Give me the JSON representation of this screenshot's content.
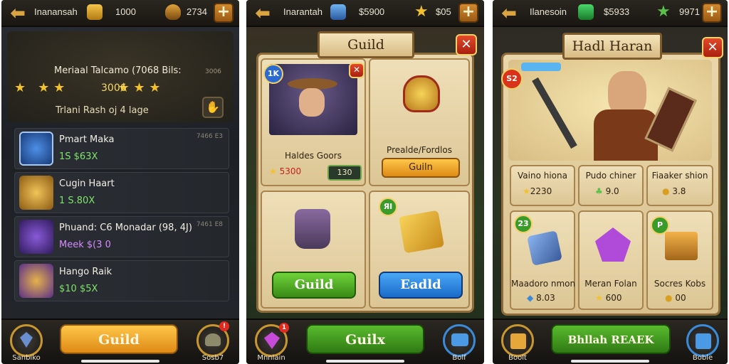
{
  "colors": {
    "gold": "#f2c12b",
    "green_btn": "#4caa22",
    "blue_btn": "#2b8fe6",
    "orange_btn": "#f0a52a",
    "close_red": "#d9331c"
  },
  "panel1": {
    "topbar": {
      "title": "Inanansah",
      "currency_value": "1000",
      "gems_value": "2734",
      "currency_icon": "coin-icon",
      "gem_icon": "shield-gem-icon"
    },
    "header": {
      "title": "Meriaal Talcamo (7068 Bils:",
      "rating": "3006",
      "subtitle": "Trlani Rash oj 4 lage",
      "corner": "3006"
    },
    "rows": [
      {
        "name": "Pmart Maka",
        "sub": "1S $63X",
        "sub_color": "#7ee36a",
        "right": "7466 E3",
        "avatar": "blue-knight-avatar"
      },
      {
        "name": "Cugin Haart",
        "sub": "1 S.80X",
        "sub_color": "#7ee36a",
        "right": "",
        "avatar": "gold-hero-avatar"
      },
      {
        "name": "Phuand: C6 Monadar (98, 4J)",
        "sub": "Meek $(3 0",
        "sub_color": "#d58cff",
        "right": "7461 E8",
        "avatar": "purple-mech-avatar"
      },
      {
        "name": "Hango Raik",
        "sub": "$10 $5X",
        "sub_color": "#7ee36a",
        "right": "",
        "avatar": "helmet-avatar"
      }
    ],
    "bottom": {
      "left_label": "Sanbiko",
      "main_button": "Guild",
      "right_label": "Sosb7",
      "right_badge": "!"
    }
  },
  "panel2": {
    "topbar": {
      "title": "Inarantah",
      "currency_value": "$5900",
      "gems_value": "$05",
      "currency_icon": "blue-gem-icon",
      "gem_icon": "star-icon"
    },
    "banner": "Guild",
    "hero_card": {
      "corner_badge": "1K",
      "name": "Haldes Goors",
      "stat": "5300",
      "level": "130"
    },
    "item_card": {
      "title": "Prealde/Fordlos",
      "button": "Guiln"
    },
    "bottom_cards": [
      {
        "item": "mug-icon",
        "button": "Guild",
        "badge": ""
      },
      {
        "item": "gold-scroll-icon",
        "button": "Eadld",
        "badge": "ЯI"
      }
    ],
    "bottom": {
      "left_label": "Mnnlain",
      "main_button": "Guilx",
      "right_label": "Bolf",
      "left_badge": "1"
    }
  },
  "panel3": {
    "topbar": {
      "title": "Ilanesoin",
      "currency_value": "$5933",
      "gems_value": "9971",
      "currency_icon": "green-gem-icon",
      "gem_icon": "star-icon"
    },
    "banner": "Hadl Haran",
    "hero_badge": "S2",
    "stats": [
      {
        "label": "Vaino hiona",
        "value": "2230"
      },
      {
        "label": "Pudo chiner",
        "value": "9.0"
      },
      {
        "label": "Fiaaker shion",
        "value": "3.8"
      }
    ],
    "items": [
      {
        "label": "Maadoro nmon",
        "value": "8.03",
        "badge": "23",
        "icon": "blue-cube-icon"
      },
      {
        "label": "Meran Folan",
        "value": "600",
        "badge": "",
        "icon": "purple-crystal-icon"
      },
      {
        "label": "Socres Kobs",
        "value": "00",
        "badge": "P",
        "icon": "gold-chest-icon"
      }
    ],
    "bottom": {
      "left_label": "Boolt",
      "main_button": "Bhllah REAEK",
      "right_label": "Boble"
    }
  }
}
